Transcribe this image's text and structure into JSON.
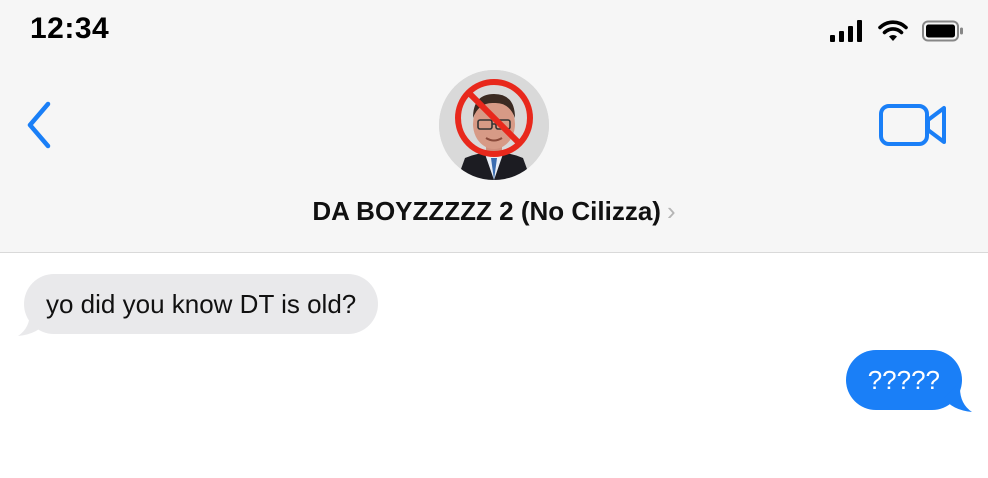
{
  "status_bar": {
    "time": "12:34",
    "icons": [
      "signal-icon",
      "wifi-icon",
      "battery-icon"
    ]
  },
  "nav": {
    "back_icon": "chevron-left-icon",
    "video_icon": "video-camera-icon",
    "group_name": "DA BOYZZZZZ 2 (No Cilizza)",
    "chevron": "›"
  },
  "messages": [
    {
      "direction": "incoming",
      "text": "yo did you know DT is old?"
    },
    {
      "direction": "outgoing",
      "text": "?????"
    }
  ],
  "colors": {
    "accent": "#1a7ff7",
    "incoming_bubble": "#e9e9eb",
    "header_bg": "#f6f6f6",
    "prohibit_red": "#e8281c"
  }
}
